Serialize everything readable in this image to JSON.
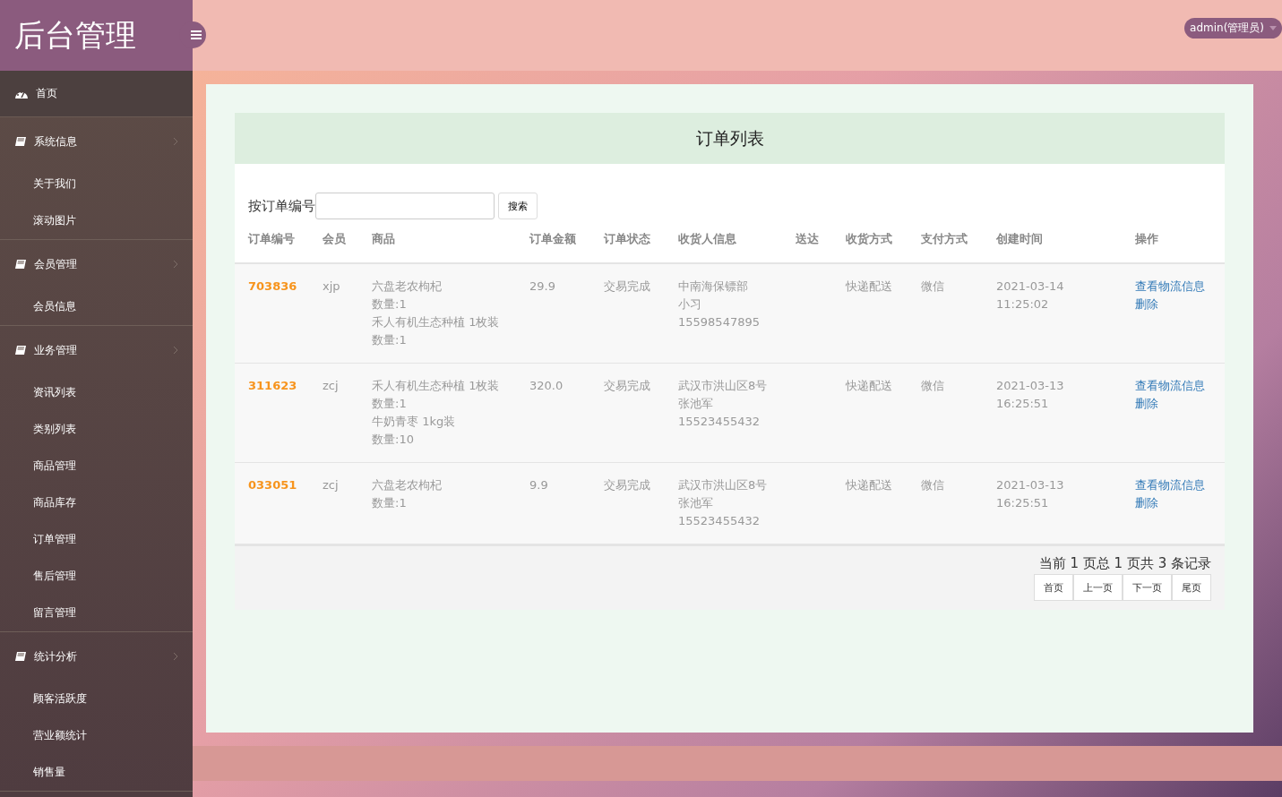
{
  "brand": "后台管理",
  "user_menu": {
    "label": "admin(管理员)"
  },
  "sidebar": {
    "items": [
      {
        "kind": "link",
        "label": "首页"
      },
      {
        "kind": "group",
        "label": "系统信息",
        "children": [
          {
            "label": "关于我们"
          },
          {
            "label": "滚动图片"
          }
        ]
      },
      {
        "kind": "group",
        "label": "会员管理",
        "children": [
          {
            "label": "会员信息"
          }
        ]
      },
      {
        "kind": "group",
        "label": "业务管理",
        "children": [
          {
            "label": "资讯列表"
          },
          {
            "label": "类别列表"
          },
          {
            "label": "商品管理"
          },
          {
            "label": "商品库存"
          },
          {
            "label": "订单管理"
          },
          {
            "label": "售后管理"
          },
          {
            "label": "留言管理"
          }
        ]
      },
      {
        "kind": "group",
        "label": "统计分析",
        "children": [
          {
            "label": "顾客活跃度"
          },
          {
            "label": "营业额统计"
          },
          {
            "label": "销售量"
          }
        ]
      }
    ]
  },
  "panel": {
    "title": "订单列表",
    "search": {
      "label": "按订单编号",
      "button": "搜索"
    },
    "table": {
      "columns": [
        "订单编号",
        "会员",
        "商品",
        "订单金额",
        "订单状态",
        "收货人信息",
        "送达",
        "收货方式",
        "支付方式",
        "创建时间",
        "操作"
      ],
      "rows": [
        {
          "order_no": "703836",
          "member": "xjp",
          "goods": [
            "六盘老农枸杞",
            "数量:1",
            "禾人有机生态种植 1枚装",
            "数量:1"
          ],
          "amount": "29.9",
          "status": "交易完成",
          "receiver": [
            "中南海保镖部",
            "小习",
            "15598547895"
          ],
          "delivered": "",
          "shipping": "快递配送",
          "payment": "微信",
          "created": [
            "2021-03-14",
            "11:25:02"
          ],
          "actions": [
            "查看物流信息",
            "删除"
          ]
        },
        {
          "order_no": "311623",
          "member": "zcj",
          "goods": [
            "禾人有机生态种植 1枚装",
            "数量:1",
            "牛奶青枣 1kg装",
            "数量:10"
          ],
          "amount": "320.0",
          "status": "交易完成",
          "receiver": [
            "武汉市洪山区8号",
            "张池军",
            "15523455432"
          ],
          "delivered": "",
          "shipping": "快递配送",
          "payment": "微信",
          "created": [
            "2021-03-13",
            "16:25:51"
          ],
          "actions": [
            "查看物流信息",
            "删除"
          ]
        },
        {
          "order_no": "033051",
          "member": "zcj",
          "goods": [
            "六盘老农枸杞",
            "数量:1"
          ],
          "amount": "9.9",
          "status": "交易完成",
          "receiver": [
            "武汉市洪山区8号",
            "张池军",
            "15523455432"
          ],
          "delivered": "",
          "shipping": "快递配送",
          "payment": "微信",
          "created": [
            "2021-03-13",
            "16:25:51"
          ],
          "actions": [
            "查看物流信息",
            "删除"
          ]
        }
      ]
    },
    "pagination": {
      "summary": "当前 1 页总 1 页共 3 条记录",
      "buttons": [
        "首页",
        "上一页",
        "下一页",
        "尾页"
      ]
    }
  }
}
